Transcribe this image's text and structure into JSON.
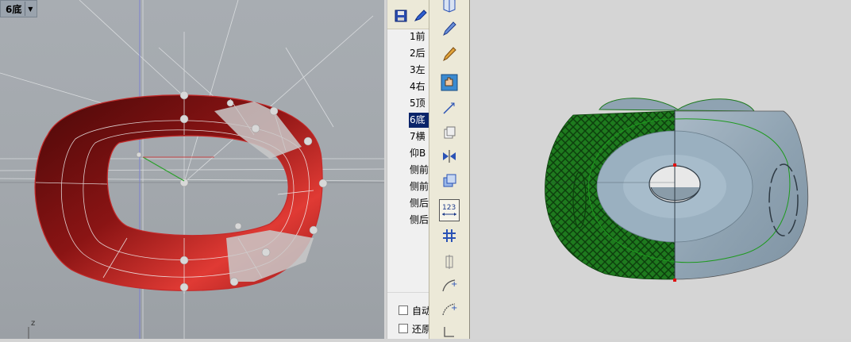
{
  "left_viewport": {
    "label": "6底",
    "axis_label": "z"
  },
  "view_panel": {
    "toolbar": [
      {
        "name": "save-icon",
        "color": "#1f3fa5"
      },
      {
        "name": "pencil-check-icon",
        "color": "#1f4fbf"
      }
    ],
    "views": [
      {
        "label": "1前",
        "selected": false
      },
      {
        "label": "2后",
        "selected": false
      },
      {
        "label": "3左",
        "selected": false
      },
      {
        "label": "4右",
        "selected": false
      },
      {
        "label": "5顶",
        "selected": false
      },
      {
        "label": "6底",
        "selected": true
      },
      {
        "label": "7横",
        "selected": false
      },
      {
        "label": "仰B",
        "selected": false
      },
      {
        "label": "侧前",
        "selected": false
      },
      {
        "label": "侧前",
        "selected": false
      },
      {
        "label": "侧后",
        "selected": false
      },
      {
        "label": "侧后",
        "selected": false
      }
    ],
    "checkboxes": [
      {
        "label": "自动",
        "checked": false
      },
      {
        "label": "还原",
        "checked": false
      }
    ]
  },
  "tool_column": {
    "tools": [
      {
        "name": "cube-select-icon"
      },
      {
        "name": "pen-blue-icon"
      },
      {
        "name": "pen-orange-icon"
      },
      {
        "name": "hand-pan-icon",
        "pressed": false
      },
      {
        "name": "arrow-line-icon"
      },
      {
        "name": "copy-pages-icon"
      },
      {
        "name": "mirror-icon"
      },
      {
        "name": "stacked-pages-icon"
      },
      {
        "name": "dimension-123-icon",
        "text": "123",
        "pressed": true
      },
      {
        "name": "grid-icon"
      },
      {
        "name": "split-icon"
      },
      {
        "name": "curve-plus-icon"
      },
      {
        "name": "curve-plus-2-icon"
      },
      {
        "name": "corner-line-icon"
      }
    ]
  },
  "colors": {
    "model_red": "#c42a2a",
    "model_green": "#1e7a1e",
    "model_steel": "#8fa3b2"
  }
}
